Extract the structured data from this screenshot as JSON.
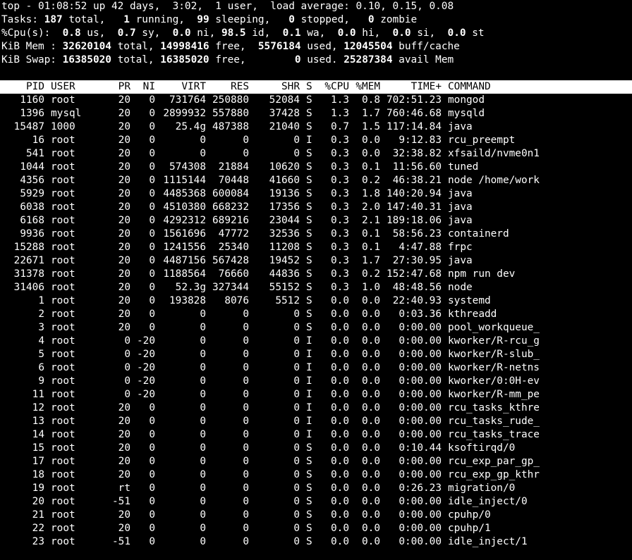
{
  "summary": {
    "top_line": "top - 01:08:52 up 42 days,  3:02,  1 user,  load average: 0.10, 0.15, 0.08",
    "tasks": {
      "label": "Tasks: ",
      "total": "187",
      "total_label": " total,   ",
      "running": "1",
      "running_label": " running,  ",
      "sleeping": "99",
      "sleeping_label": " sleeping,   ",
      "stopped": "0",
      "stopped_label": " stopped,   ",
      "zombie": "0",
      "zombie_label": " zombie"
    },
    "cpu": {
      "label": "%Cpu(s):  ",
      "us": "0.8",
      "us_label": " us,  ",
      "sy": "0.7",
      "sy_label": " sy,  ",
      "ni": "0.0",
      "ni_label": " ni, ",
      "id": "98.5",
      "id_label": " id,  ",
      "wa": "0.1",
      "wa_label": " wa,  ",
      "hi": "0.0",
      "hi_label": " hi,  ",
      "si": "0.0",
      "si_label": " si,  ",
      "st": "0.0",
      "st_label": " st"
    },
    "mem": {
      "label": "KiB Mem : ",
      "total": "32620104",
      "total_label": " total, ",
      "free": "14998416",
      "free_label": " free,  ",
      "used": "5576184",
      "used_label": " used, ",
      "buff": "12045504",
      "buff_label": " buff/cache"
    },
    "swap": {
      "label": "KiB Swap: ",
      "total": "16385020",
      "total_label": " total, ",
      "free": "16385020",
      "free_label": " free,        ",
      "used": "0",
      "used_label": " used. ",
      "avail": "25287384",
      "avail_label": " avail Mem"
    }
  },
  "columns": [
    "PID",
    "USER",
    "PR",
    "NI",
    "VIRT",
    "RES",
    "SHR",
    "S",
    "%CPU",
    "%MEM",
    "TIME+",
    "COMMAND"
  ],
  "processes": [
    [
      "1160",
      "root",
      "20",
      "0",
      "731764",
      "250880",
      "52084",
      "S",
      "1.3",
      "0.8",
      "702:51.23",
      "mongod"
    ],
    [
      "1396",
      "mysql",
      "20",
      "0",
      "2899932",
      "557880",
      "37428",
      "S",
      "1.3",
      "1.7",
      "760:46.68",
      "mysqld"
    ],
    [
      "15487",
      "1000",
      "20",
      "0",
      "25.4g",
      "487388",
      "21040",
      "S",
      "0.7",
      "1.5",
      "117:14.84",
      "java"
    ],
    [
      "16",
      "root",
      "20",
      "0",
      "0",
      "0",
      "0",
      "I",
      "0.3",
      "0.0",
      "9:12.83",
      "rcu_preempt"
    ],
    [
      "541",
      "root",
      "20",
      "0",
      "0",
      "0",
      "0",
      "S",
      "0.3",
      "0.0",
      "32:38.82",
      "xfsaild/nvme0n1"
    ],
    [
      "1044",
      "root",
      "20",
      "0",
      "574308",
      "21884",
      "10620",
      "S",
      "0.3",
      "0.1",
      "11:56.60",
      "tuned"
    ],
    [
      "4356",
      "root",
      "20",
      "0",
      "1115144",
      "70448",
      "41660",
      "S",
      "0.3",
      "0.2",
      "46:38.21",
      "node /home/work"
    ],
    [
      "5929",
      "root",
      "20",
      "0",
      "4485368",
      "600084",
      "19136",
      "S",
      "0.3",
      "1.8",
      "140:20.94",
      "java"
    ],
    [
      "6038",
      "root",
      "20",
      "0",
      "4510380",
      "668232",
      "17356",
      "S",
      "0.3",
      "2.0",
      "147:40.31",
      "java"
    ],
    [
      "6168",
      "root",
      "20",
      "0",
      "4292312",
      "689216",
      "23044",
      "S",
      "0.3",
      "2.1",
      "189:18.06",
      "java"
    ],
    [
      "9936",
      "root",
      "20",
      "0",
      "1561696",
      "47772",
      "32536",
      "S",
      "0.3",
      "0.1",
      "58:56.23",
      "containerd"
    ],
    [
      "15288",
      "root",
      "20",
      "0",
      "1241556",
      "25340",
      "11208",
      "S",
      "0.3",
      "0.1",
      "4:47.88",
      "frpc"
    ],
    [
      "22671",
      "root",
      "20",
      "0",
      "4487156",
      "567428",
      "19452",
      "S",
      "0.3",
      "1.7",
      "27:30.95",
      "java"
    ],
    [
      "31378",
      "root",
      "20",
      "0",
      "1188564",
      "76660",
      "44836",
      "S",
      "0.3",
      "0.2",
      "152:47.68",
      "npm run dev"
    ],
    [
      "31406",
      "root",
      "20",
      "0",
      "52.3g",
      "327344",
      "55152",
      "S",
      "0.3",
      "1.0",
      "48:48.56",
      "node"
    ],
    [
      "1",
      "root",
      "20",
      "0",
      "193828",
      "8076",
      "5512",
      "S",
      "0.0",
      "0.0",
      "22:40.93",
      "systemd"
    ],
    [
      "2",
      "root",
      "20",
      "0",
      "0",
      "0",
      "0",
      "S",
      "0.0",
      "0.0",
      "0:03.36",
      "kthreadd"
    ],
    [
      "3",
      "root",
      "20",
      "0",
      "0",
      "0",
      "0",
      "S",
      "0.0",
      "0.0",
      "0:00.00",
      "pool_workqueue_"
    ],
    [
      "4",
      "root",
      "0",
      "-20",
      "0",
      "0",
      "0",
      "I",
      "0.0",
      "0.0",
      "0:00.00",
      "kworker/R-rcu_g"
    ],
    [
      "5",
      "root",
      "0",
      "-20",
      "0",
      "0",
      "0",
      "I",
      "0.0",
      "0.0",
      "0:00.00",
      "kworker/R-slub_"
    ],
    [
      "6",
      "root",
      "0",
      "-20",
      "0",
      "0",
      "0",
      "I",
      "0.0",
      "0.0",
      "0:00.00",
      "kworker/R-netns"
    ],
    [
      "9",
      "root",
      "0",
      "-20",
      "0",
      "0",
      "0",
      "I",
      "0.0",
      "0.0",
      "0:00.00",
      "kworker/0:0H-ev"
    ],
    [
      "11",
      "root",
      "0",
      "-20",
      "0",
      "0",
      "0",
      "I",
      "0.0",
      "0.0",
      "0:00.00",
      "kworker/R-mm_pe"
    ],
    [
      "12",
      "root",
      "20",
      "0",
      "0",
      "0",
      "0",
      "I",
      "0.0",
      "0.0",
      "0:00.00",
      "rcu_tasks_kthre"
    ],
    [
      "13",
      "root",
      "20",
      "0",
      "0",
      "0",
      "0",
      "I",
      "0.0",
      "0.0",
      "0:00.00",
      "rcu_tasks_rude_"
    ],
    [
      "14",
      "root",
      "20",
      "0",
      "0",
      "0",
      "0",
      "I",
      "0.0",
      "0.0",
      "0:00.00",
      "rcu_tasks_trace"
    ],
    [
      "15",
      "root",
      "20",
      "0",
      "0",
      "0",
      "0",
      "S",
      "0.0",
      "0.0",
      "0:10.44",
      "ksoftirqd/0"
    ],
    [
      "17",
      "root",
      "20",
      "0",
      "0",
      "0",
      "0",
      "S",
      "0.0",
      "0.0",
      "0:00.00",
      "rcu_exp_par_gp_"
    ],
    [
      "18",
      "root",
      "20",
      "0",
      "0",
      "0",
      "0",
      "S",
      "0.0",
      "0.0",
      "0:00.00",
      "rcu_exp_gp_kthr"
    ],
    [
      "19",
      "root",
      "rt",
      "0",
      "0",
      "0",
      "0",
      "S",
      "0.0",
      "0.0",
      "0:26.23",
      "migration/0"
    ],
    [
      "20",
      "root",
      "-51",
      "0",
      "0",
      "0",
      "0",
      "S",
      "0.0",
      "0.0",
      "0:00.00",
      "idle_inject/0"
    ],
    [
      "21",
      "root",
      "20",
      "0",
      "0",
      "0",
      "0",
      "S",
      "0.0",
      "0.0",
      "0:00.00",
      "cpuhp/0"
    ],
    [
      "22",
      "root",
      "20",
      "0",
      "0",
      "0",
      "0",
      "S",
      "0.0",
      "0.0",
      "0:00.00",
      "cpuhp/1"
    ],
    [
      "23",
      "root",
      "-51",
      "0",
      "0",
      "0",
      "0",
      "S",
      "0.0",
      "0.0",
      "0:00.00",
      "idle_inject/1"
    ]
  ],
  "colors": {
    "background": "#000000",
    "foreground": "#ffffff",
    "header_bg": "#ffffff",
    "header_fg": "#000000"
  }
}
